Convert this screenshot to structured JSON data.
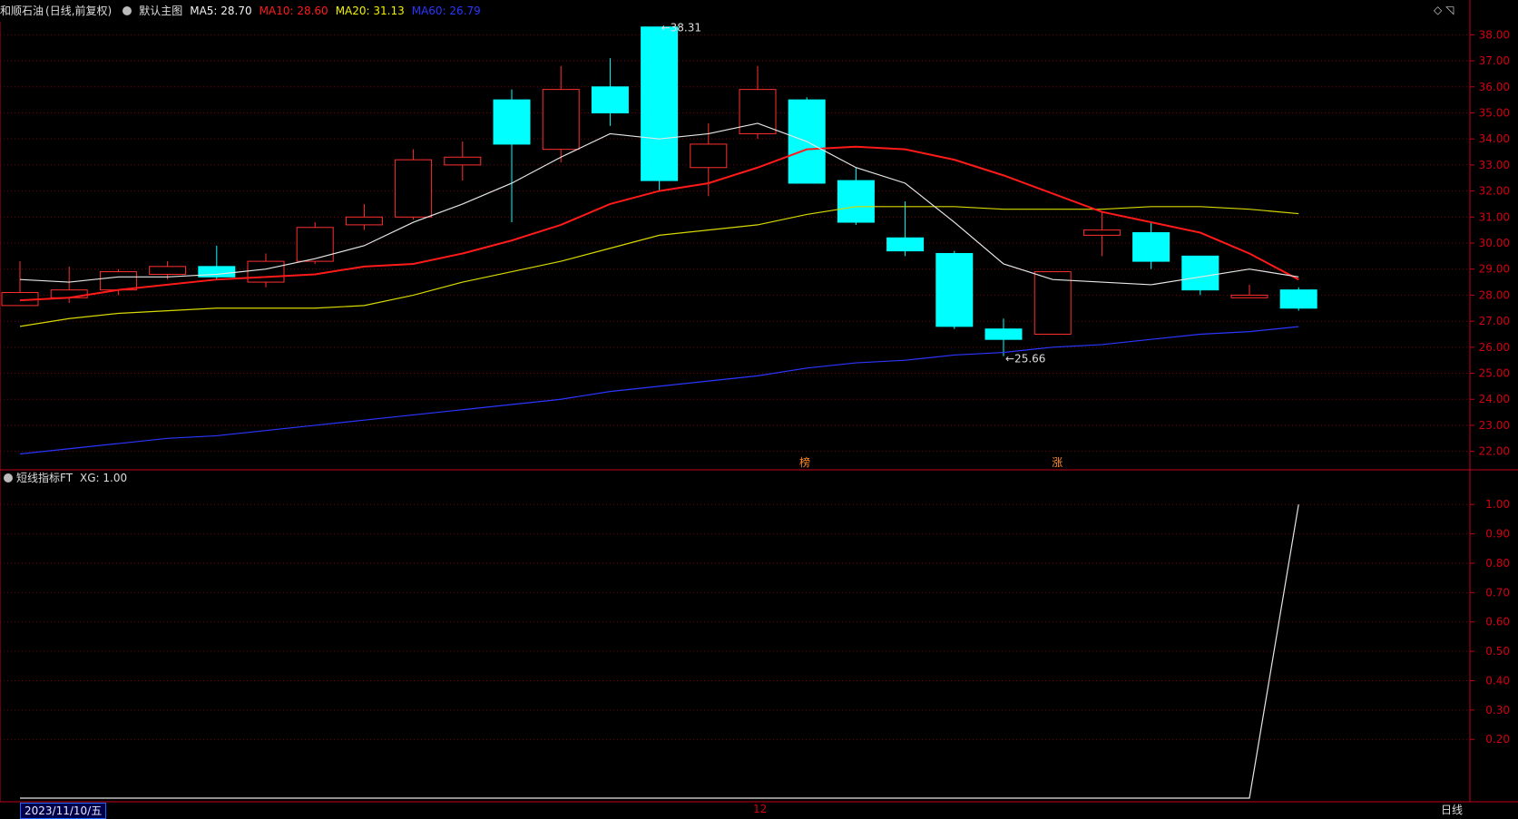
{
  "header": {
    "stock": "和顺石油",
    "period": "(日线,前复权)",
    "chart_name": "默认主图",
    "ma5": "MA5: 28.70",
    "ma10": "MA10: 28.60",
    "ma20": "MA20: 31.13",
    "ma60": "MA60: 26.79",
    "colors": {
      "ma5": "#f2f2f2",
      "ma10": "#ff1a1a",
      "ma20": "#f2f200",
      "ma60": "#2a36ff"
    }
  },
  "sub": {
    "title": "短线指标FT",
    "xg": "XG: 1.00"
  },
  "marks": {
    "top_high": "38.31",
    "low": "25.66",
    "tag1": "榜",
    "tag2": "涨"
  },
  "bottom": {
    "date": "2023/11/10/五",
    "month": "12",
    "period": "日线"
  },
  "chart_data": {
    "type": "candlestick",
    "ylim": [
      21.5,
      38.5
    ],
    "y_ticks": [
      "38.00",
      "37.00",
      "36.00",
      "35.00",
      "34.00",
      "33.00",
      "32.00",
      "31.00",
      "30.00",
      "29.00",
      "28.00",
      "27.00",
      "26.00",
      "25.00",
      "24.00",
      "23.00",
      "22.00"
    ],
    "candles": [
      {
        "o": 27.6,
        "c": 28.1,
        "h": 29.3,
        "l": 27.6,
        "dir": "up"
      },
      {
        "o": 27.9,
        "c": 28.2,
        "h": 29.1,
        "l": 27.7,
        "dir": "up"
      },
      {
        "o": 28.2,
        "c": 28.9,
        "h": 29.0,
        "l": 28.0,
        "dir": "up"
      },
      {
        "o": 28.8,
        "c": 29.1,
        "h": 29.3,
        "l": 28.6,
        "dir": "up"
      },
      {
        "o": 29.1,
        "c": 28.7,
        "h": 29.9,
        "l": 28.6,
        "dir": "down"
      },
      {
        "o": 28.5,
        "c": 29.3,
        "h": 29.6,
        "l": 28.3,
        "dir": "up"
      },
      {
        "o": 29.3,
        "c": 30.6,
        "h": 30.8,
        "l": 29.2,
        "dir": "up"
      },
      {
        "o": 30.7,
        "c": 31.0,
        "h": 31.5,
        "l": 30.5,
        "dir": "up"
      },
      {
        "o": 31.0,
        "c": 33.2,
        "h": 33.6,
        "l": 30.9,
        "dir": "up"
      },
      {
        "o": 33.0,
        "c": 33.3,
        "h": 33.9,
        "l": 32.4,
        "dir": "up"
      },
      {
        "o": 35.5,
        "c": 33.8,
        "h": 35.9,
        "l": 30.8,
        "dir": "down"
      },
      {
        "o": 33.6,
        "c": 35.9,
        "h": 36.8,
        "l": 33.1,
        "dir": "up"
      },
      {
        "o": 36.0,
        "c": 35.0,
        "h": 37.1,
        "l": 34.5,
        "dir": "down"
      },
      {
        "o": 38.3,
        "c": 32.4,
        "h": 38.31,
        "l": 32.0,
        "dir": "down"
      },
      {
        "o": 32.9,
        "c": 33.8,
        "h": 34.6,
        "l": 31.8,
        "dir": "up"
      },
      {
        "o": 34.2,
        "c": 35.9,
        "h": 36.8,
        "l": 34.0,
        "dir": "up"
      },
      {
        "o": 35.5,
        "c": 32.3,
        "h": 35.6,
        "l": 32.3,
        "dir": "down"
      },
      {
        "o": 32.4,
        "c": 30.8,
        "h": 32.9,
        "l": 30.7,
        "dir": "down"
      },
      {
        "o": 30.2,
        "c": 29.7,
        "h": 31.6,
        "l": 29.5,
        "dir": "down"
      },
      {
        "o": 29.6,
        "c": 26.8,
        "h": 29.7,
        "l": 26.7,
        "dir": "down"
      },
      {
        "o": 26.7,
        "c": 26.3,
        "h": 27.1,
        "l": 25.66,
        "dir": "down"
      },
      {
        "o": 26.5,
        "c": 28.9,
        "h": 28.9,
        "l": 26.5,
        "dir": "up"
      },
      {
        "o": 30.3,
        "c": 30.5,
        "h": 31.2,
        "l": 29.5,
        "dir": "up"
      },
      {
        "o": 30.4,
        "c": 29.3,
        "h": 30.8,
        "l": 29.0,
        "dir": "down"
      },
      {
        "o": 29.5,
        "c": 28.2,
        "h": 29.5,
        "l": 28.0,
        "dir": "down"
      },
      {
        "o": 27.9,
        "c": 28.0,
        "h": 28.4,
        "l": 27.9,
        "dir": "up"
      },
      {
        "o": 28.2,
        "c": 27.5,
        "h": 28.3,
        "l": 27.4,
        "dir": "down"
      }
    ],
    "ma5": [
      28.6,
      28.5,
      28.7,
      28.7,
      28.8,
      29.0,
      29.4,
      29.9,
      30.8,
      31.5,
      32.3,
      33.3,
      34.2,
      34.0,
      34.2,
      34.6,
      33.9,
      32.9,
      32.3,
      30.8,
      29.2,
      28.6,
      28.5,
      28.4,
      28.7,
      29.0,
      28.7
    ],
    "ma10": [
      27.8,
      27.9,
      28.2,
      28.4,
      28.6,
      28.7,
      28.8,
      29.1,
      29.2,
      29.6,
      30.1,
      30.7,
      31.5,
      32.0,
      32.3,
      32.9,
      33.6,
      33.7,
      33.6,
      33.2,
      32.6,
      31.9,
      31.2,
      30.8,
      30.4,
      29.6,
      28.6
    ],
    "ma20": [
      26.8,
      27.1,
      27.3,
      27.4,
      27.5,
      27.5,
      27.5,
      27.6,
      28.0,
      28.5,
      28.9,
      29.3,
      29.8,
      30.3,
      30.5,
      30.7,
      31.1,
      31.4,
      31.4,
      31.4,
      31.3,
      31.3,
      31.3,
      31.4,
      31.4,
      31.3,
      31.13
    ],
    "ma60": [
      21.9,
      22.1,
      22.3,
      22.5,
      22.6,
      22.8,
      23.0,
      23.2,
      23.4,
      23.6,
      23.8,
      24.0,
      24.3,
      24.5,
      24.7,
      24.9,
      25.2,
      25.4,
      25.5,
      25.7,
      25.8,
      26.0,
      26.1,
      26.3,
      26.5,
      26.6,
      26.79
    ],
    "sub_ylim": [
      0.0,
      1.05
    ],
    "sub_y_ticks": [
      "1.00",
      "0.90",
      "0.80",
      "0.70",
      "0.60",
      "0.50",
      "0.40",
      "0.30",
      "0.20"
    ],
    "xg": [
      0,
      0,
      0,
      0,
      0,
      0,
      0,
      0,
      0,
      0,
      0,
      0,
      0,
      0,
      0,
      0,
      0,
      0,
      0,
      0,
      0,
      0,
      0,
      0,
      0,
      0,
      1.0
    ]
  }
}
